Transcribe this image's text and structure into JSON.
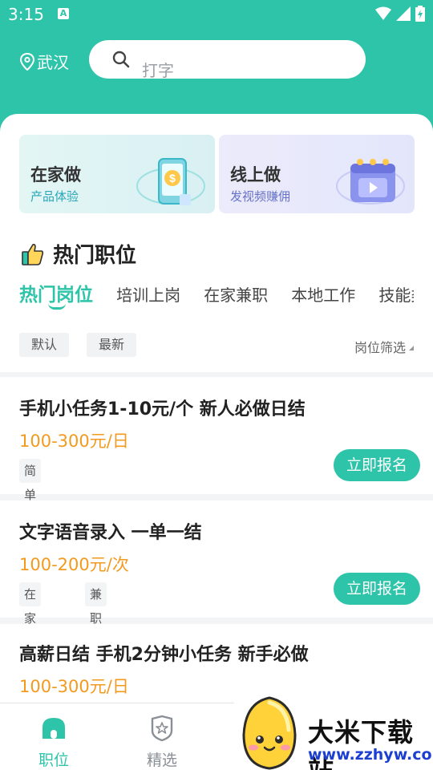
{
  "status": {
    "time": "3:15",
    "a_icon_letter": "A"
  },
  "header": {
    "city": "武汉",
    "search_placeholder": "打字"
  },
  "banners": [
    {
      "title": "在家做",
      "subtitle": "产品体验",
      "icon": "phone-money-icon"
    },
    {
      "title": "线上做",
      "subtitle": "发视频赚佣",
      "icon": "video-calendar-icon"
    }
  ],
  "section": {
    "title": "热门职位",
    "icon": "thumbs-up-icon"
  },
  "tabs": [
    "热门岗位",
    "培训上岗",
    "在家兼职",
    "本地工作",
    "技能类"
  ],
  "filters": {
    "default_label": "默认",
    "latest_label": "最新",
    "position_filter_label": "岗位筛选"
  },
  "jobs": [
    {
      "title": "手机小任务1-10元/个 新人必做日结",
      "salary": "100-300元/日",
      "tags": [
        "简单易做"
      ],
      "button": "立即报名"
    },
    {
      "title": "文字语音录入 一单一结",
      "salary": "100-200元/次",
      "tags": [
        "在家兼职",
        "兼职副业"
      ],
      "button": "立即报名"
    },
    {
      "title": "高薪日结 手机2分钟小任务 新手必做",
      "salary": "100-300元/日",
      "tags": [],
      "button": ""
    }
  ],
  "bottom_nav": [
    {
      "label": "职位",
      "icon": "home-icon",
      "active": true
    },
    {
      "label": "精选",
      "icon": "badge-star-icon",
      "active": false
    }
  ],
  "watermark": {
    "title": "大米下载站",
    "url": "www.zzhyw.com"
  },
  "colors": {
    "accent": "#2ec4a9",
    "salary": "#f39a1e",
    "text": "#222222"
  }
}
